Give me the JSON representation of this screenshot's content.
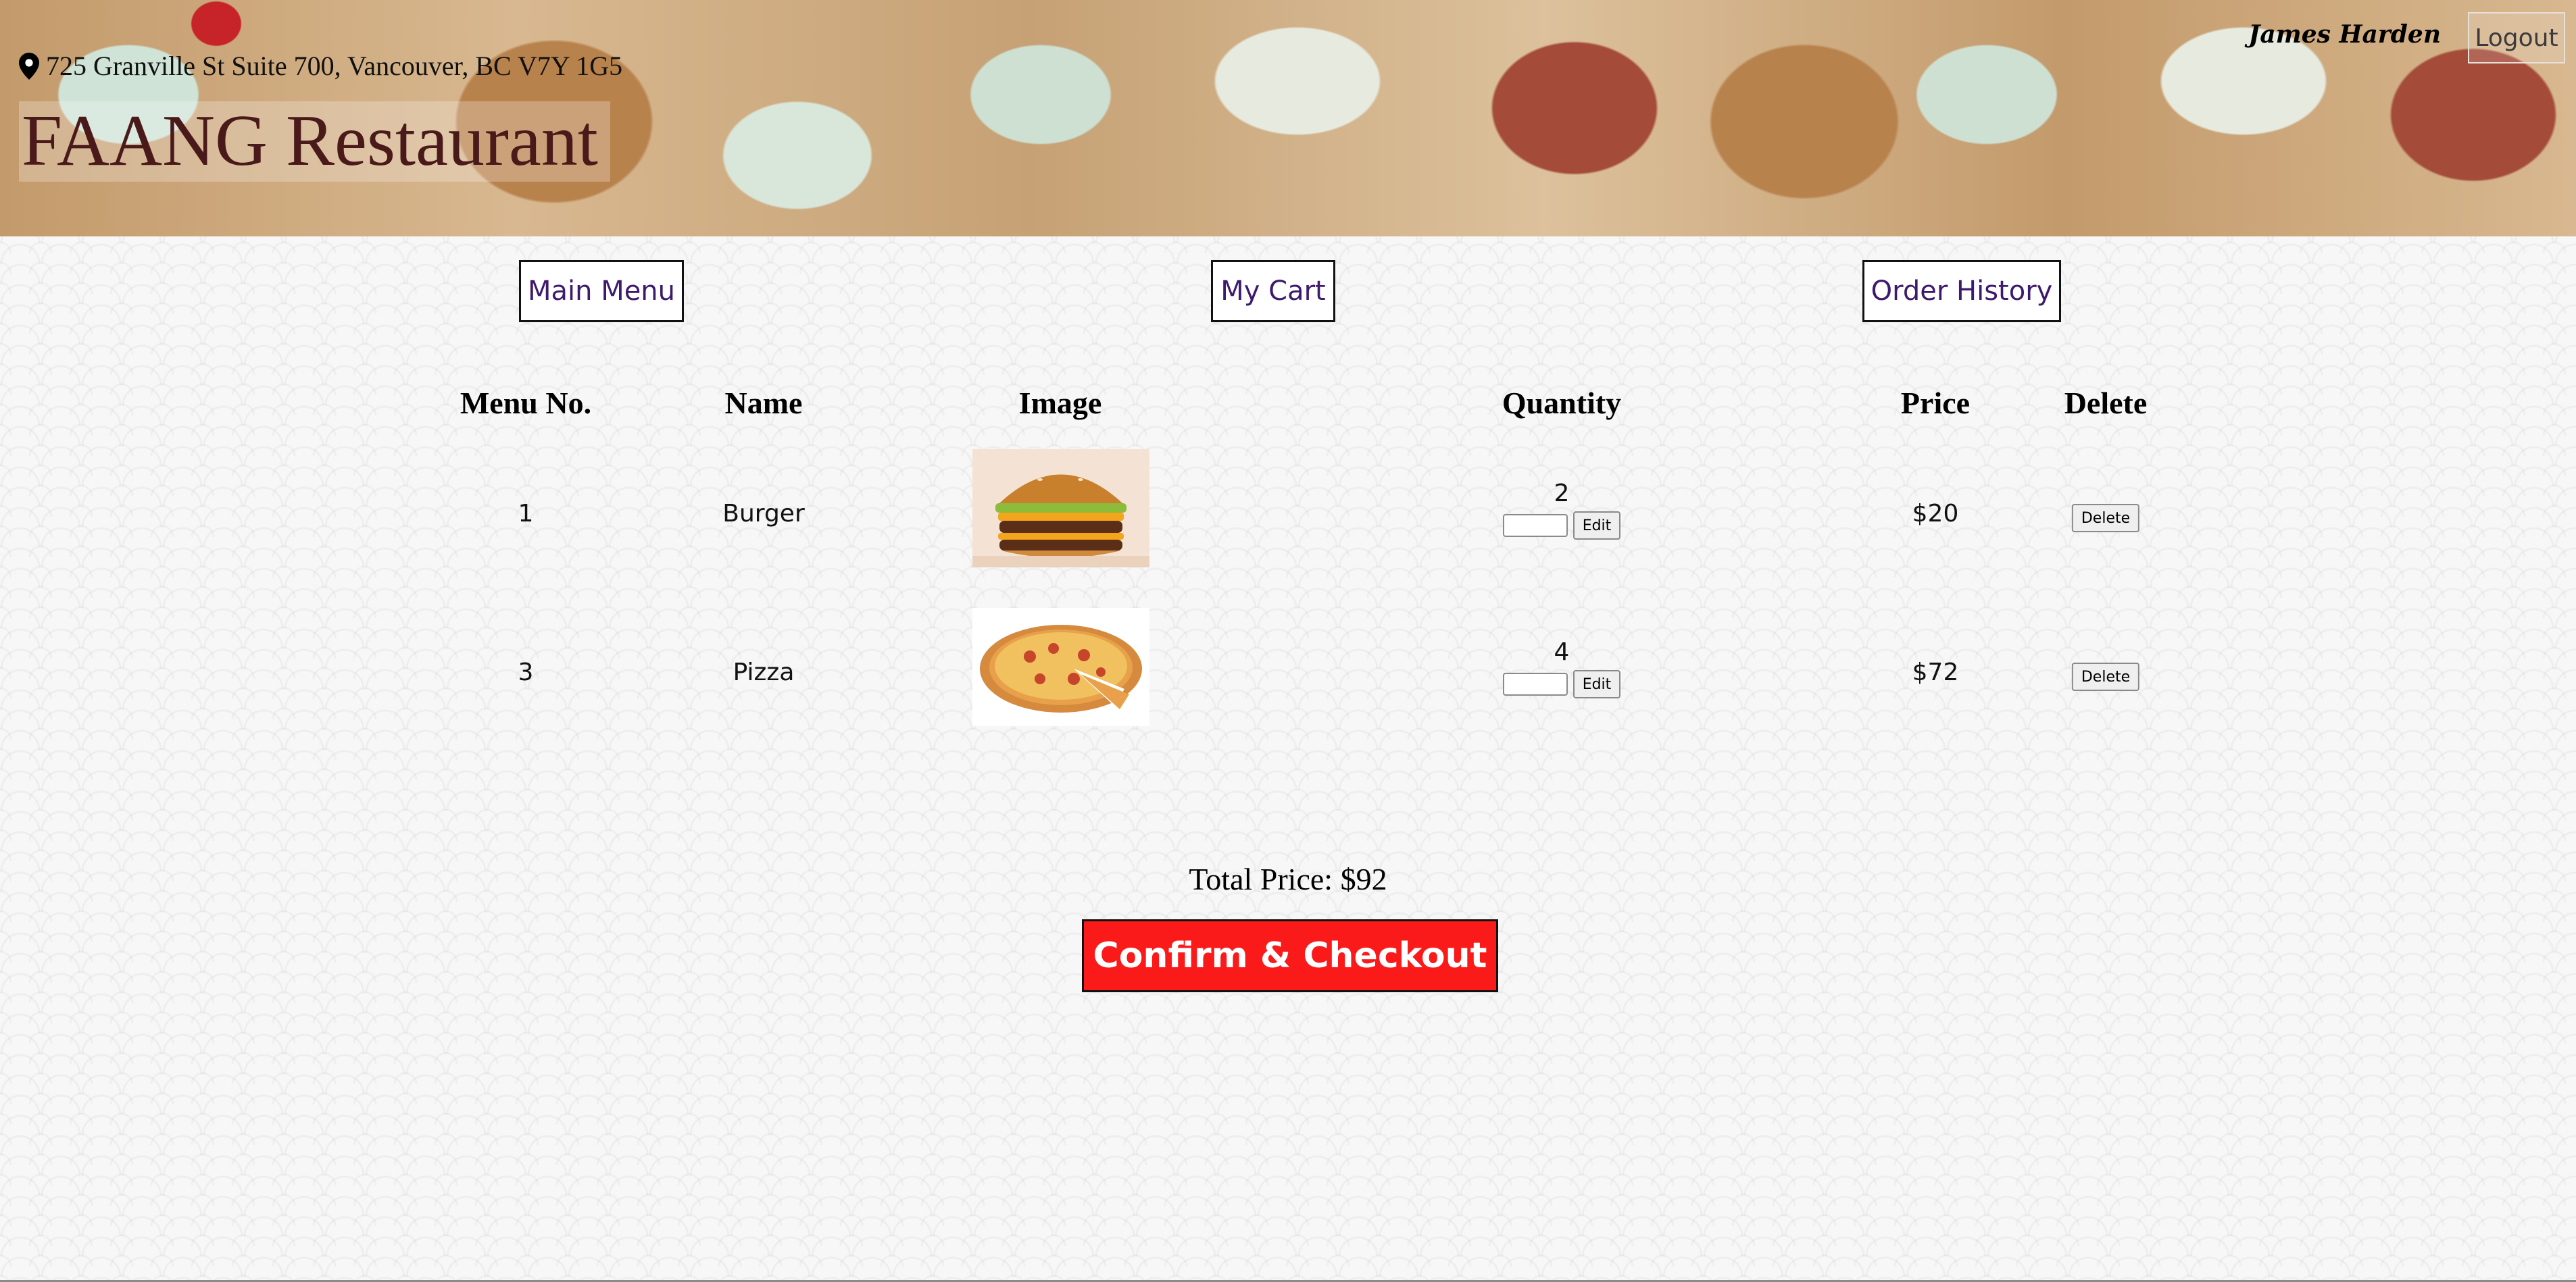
{
  "header": {
    "address": "725 Granville St Suite 700, Vancouver, BC V7Y 1G5",
    "title": "FAANG Restaurant",
    "user_name": "James Harden",
    "logout_label": "Logout"
  },
  "nav": {
    "main_menu": "Main Menu",
    "my_cart": "My Cart",
    "order_history": "Order History"
  },
  "cart": {
    "columns": [
      "Menu No.",
      "Name",
      "Image",
      "Quantity",
      "Price",
      "Delete"
    ],
    "rows": [
      {
        "menu_no": "1",
        "name": "Burger",
        "image_icon": "burger-photo",
        "quantity": "2",
        "edit_label": "Edit",
        "price": "$20",
        "delete_label": "Delete"
      },
      {
        "menu_no": "3",
        "name": "Pizza",
        "image_icon": "pizza-photo",
        "quantity": "4",
        "edit_label": "Edit",
        "price": "$72",
        "delete_label": "Delete"
      }
    ]
  },
  "summary": {
    "total_price": "Total Price: $92",
    "checkout_label": "Confirm & Checkout"
  },
  "colors": {
    "title": "#4a1a1a",
    "nav_text": "#3e1a6e",
    "checkout_bg": "#fa1a1a"
  }
}
